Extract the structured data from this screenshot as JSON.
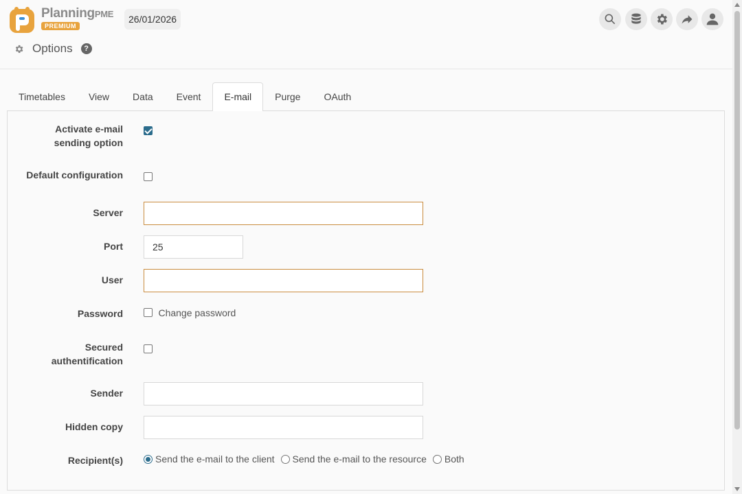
{
  "header": {
    "logo_word": "Planning",
    "logo_word_suffix": "PME",
    "logo_badge": "PREMIUM",
    "date": "26/01/2026",
    "toolbar_icons": [
      "search-icon",
      "database-icon",
      "gear-icon",
      "share-icon",
      "user-icon"
    ]
  },
  "page": {
    "title": "Options",
    "help": "?"
  },
  "tabs": [
    {
      "label": "Timetables",
      "active": false
    },
    {
      "label": "View",
      "active": false
    },
    {
      "label": "Data",
      "active": false
    },
    {
      "label": "Event",
      "active": false
    },
    {
      "label": "E-mail",
      "active": true
    },
    {
      "label": "Purge",
      "active": false
    },
    {
      "label": "OAuth",
      "active": false
    }
  ],
  "form": {
    "activate_email": {
      "label_line1": "Activate e-mail",
      "label_line2": "sending option",
      "checked": true
    },
    "default_configuration": {
      "label": "Default configuration",
      "checked": false
    },
    "server": {
      "label": "Server",
      "value": ""
    },
    "port": {
      "label": "Port",
      "value": "25"
    },
    "user": {
      "label": "User",
      "value": ""
    },
    "password": {
      "label": "Password",
      "change_label": "Change password",
      "checked": false
    },
    "secured_auth": {
      "label_line1": "Secured",
      "label_line2": "authentification",
      "checked": false
    },
    "sender": {
      "label": "Sender",
      "value": ""
    },
    "hidden_copy": {
      "label": "Hidden copy",
      "value": ""
    },
    "recipients": {
      "label": "Recipient(s)",
      "options": [
        {
          "label": "Send the e-mail to the client",
          "selected": true
        },
        {
          "label": "Send the e-mail to the resource",
          "selected": false
        },
        {
          "label": "Both",
          "selected": false
        }
      ]
    }
  },
  "colors": {
    "accent": "#2b6c8c",
    "warning_border": "#c98b3d",
    "logo_orange": "#e8a33d"
  }
}
